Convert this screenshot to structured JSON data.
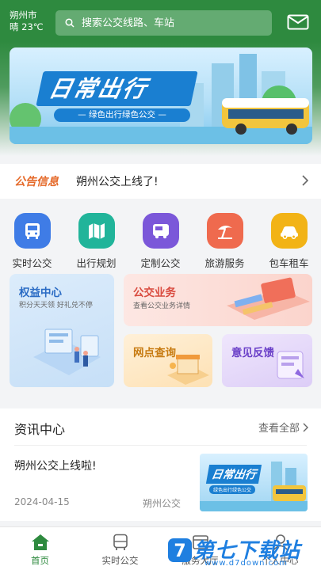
{
  "header": {
    "city": "朔州市",
    "weather": "晴 23℃",
    "search_placeholder": "搜索公交线路、车站"
  },
  "banner": {
    "title": "日常出行",
    "subtitle": "— 绿色出行绿色公交 —"
  },
  "notice": {
    "tag": "公告信息",
    "text": "朔州公交上线了!"
  },
  "quick_menu": [
    {
      "label": "实时公交",
      "icon": "bus-icon",
      "color": "#3f7ce6"
    },
    {
      "label": "出行规划",
      "icon": "map-icon",
      "color": "#21b49a"
    },
    {
      "label": "定制公交",
      "icon": "custom-bus-icon",
      "color": "#7b57d9"
    },
    {
      "label": "旅游服务",
      "icon": "beach-icon",
      "color": "#ef6a4e"
    },
    {
      "label": "包车租车",
      "icon": "car-icon",
      "color": "#f2b316"
    }
  ],
  "cards": {
    "rights": {
      "title": "权益中心",
      "subtitle": "积分天天领 好礼兑不停"
    },
    "business": {
      "title": "公交业务",
      "subtitle": "查看公交业务详情"
    },
    "outlet": {
      "title": "网点查询"
    },
    "feedback": {
      "title": "意见反馈"
    }
  },
  "news": {
    "heading": "资讯中心",
    "more": "查看全部",
    "items": [
      {
        "title": "朔州公交上线啦!",
        "date": "2024-04-15",
        "source": "朔州公交",
        "thumb_title": "日常出行",
        "thumb_sub": "绿色出行绿色公交"
      }
    ]
  },
  "tabs": [
    {
      "label": "首页",
      "active": true
    },
    {
      "label": "实时公交",
      "active": false
    },
    {
      "label": "服务大厅",
      "active": false
    },
    {
      "label": "个人中心",
      "active": false
    }
  ],
  "watermark": {
    "title": "第七下载站",
    "url": "www.d7down.com"
  },
  "colors": {
    "brand": "#2e8a3f",
    "accent_orange": "#e56a2a",
    "watermark_blue": "#1f7fe0"
  }
}
